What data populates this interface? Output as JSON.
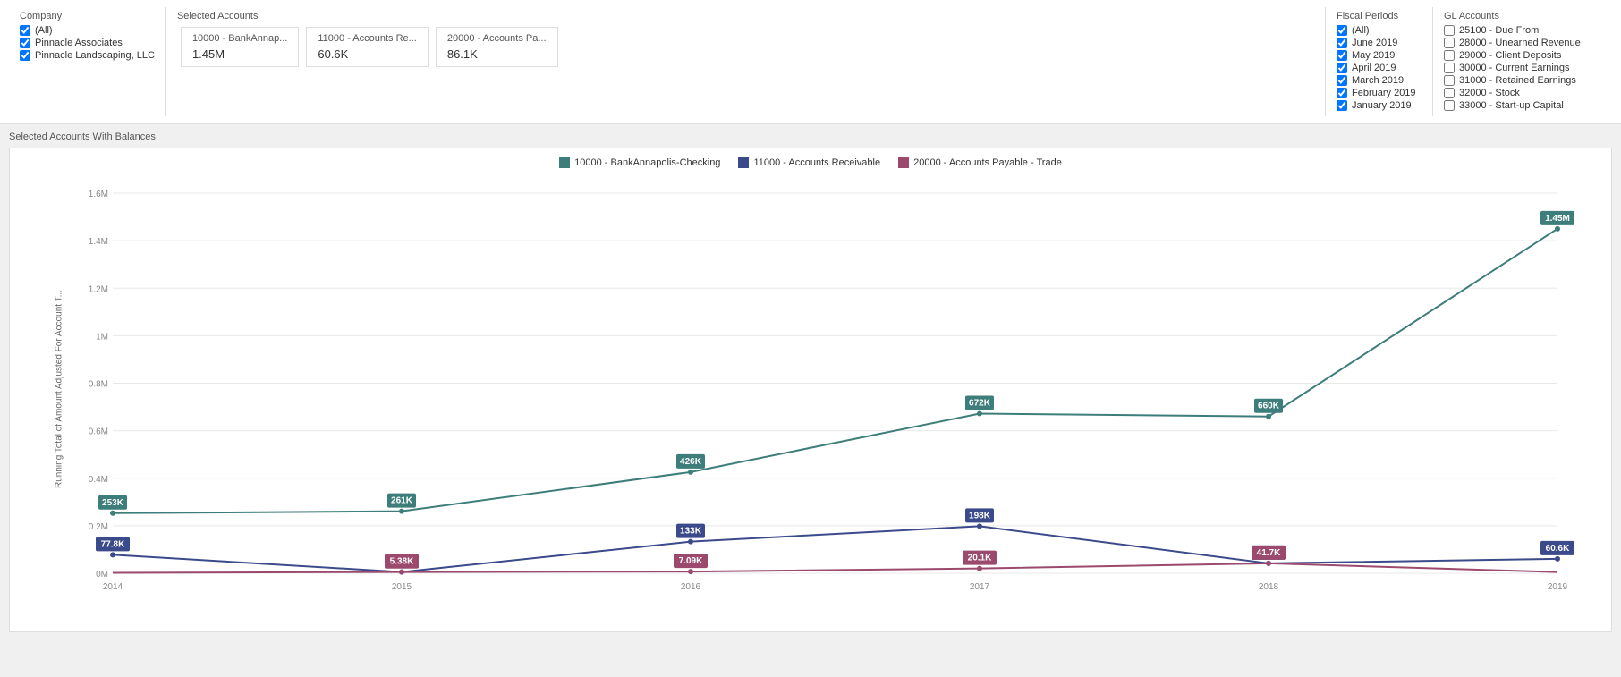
{
  "filters": {
    "company": {
      "title": "Company",
      "items": [
        {
          "label": "(All)",
          "checked": true
        },
        {
          "label": "Pinnacle Associates",
          "checked": true
        },
        {
          "label": "Pinnacle Landscaping, LLC",
          "checked": true
        }
      ]
    },
    "selected_accounts": {
      "title": "Selected Accounts",
      "cards": [
        {
          "name": "10000 - BankAnnap...",
          "value": "1.45M"
        },
        {
          "name": "11000 - Accounts Re...",
          "value": "60.6K"
        },
        {
          "name": "20000 - Accounts Pa...",
          "value": "86.1K"
        }
      ]
    },
    "fiscal_periods": {
      "title": "Fiscal Periods",
      "items": [
        {
          "label": "(All)",
          "checked": true
        },
        {
          "label": "June 2019",
          "checked": true
        },
        {
          "label": "May 2019",
          "checked": true
        },
        {
          "label": "April 2019",
          "checked": true
        },
        {
          "label": "March 2019",
          "checked": true
        },
        {
          "label": "February 2019",
          "checked": true
        },
        {
          "label": "January 2019",
          "checked": true
        }
      ]
    },
    "gl_accounts": {
      "title": "GL Accounts",
      "items": [
        {
          "label": "25100 - Due From",
          "checked": false
        },
        {
          "label": "28000 - Unearned Revenue",
          "checked": false
        },
        {
          "label": "29000 - Client Deposits",
          "checked": false
        },
        {
          "label": "30000 - Current Earnings",
          "checked": false
        },
        {
          "label": "31000 - Retained Earnings",
          "checked": false
        },
        {
          "label": "32000 - Stock",
          "checked": false
        },
        {
          "label": "33000 - Start-up Capital",
          "checked": false
        }
      ]
    }
  },
  "chart": {
    "section_title": "Selected Accounts With Balances",
    "y_axis_label": "Running Total of Amount Adjusted For Account T...",
    "legend": [
      {
        "label": "10000 - BankAnnapolis-Checking",
        "color": "#3d7d7a"
      },
      {
        "label": "11000 - Accounts Receivable",
        "color": "#3b4a8a"
      },
      {
        "label": "20000 - Accounts Payable - Trade",
        "color": "#9b4a6e"
      }
    ],
    "y_ticks": [
      "1.6M",
      "1.4M",
      "1.2M",
      "1M",
      "0.8M",
      "0.6M",
      "0.4M",
      "0.2M",
      "0M"
    ],
    "x_ticks": [
      "2014",
      "2015",
      "2016",
      "2017",
      "2018",
      "2019"
    ],
    "series": [
      {
        "name": "10000 - BankAnnapolis-Checking",
        "color": "#3d7d7a",
        "points": [
          {
            "x": "2014",
            "y": 253,
            "label": "253K"
          },
          {
            "x": "2015",
            "y": 261,
            "label": "261K"
          },
          {
            "x": "2016",
            "y": 426,
            "label": "426K"
          },
          {
            "x": "2017",
            "y": 672,
            "label": "672K"
          },
          {
            "x": "2018",
            "y": 660,
            "label": "660K"
          },
          {
            "x": "2019",
            "y": 1450,
            "label": "1.45M"
          }
        ]
      },
      {
        "name": "11000 - Accounts Receivable",
        "color": "#3b4a8a",
        "points": [
          {
            "x": "2014",
            "y": 77.8,
            "label": "77.8K"
          },
          {
            "x": "2015",
            "y": 5.38,
            "label": "5.38K"
          },
          {
            "x": "2016",
            "y": 133,
            "label": "133K"
          },
          {
            "x": "2017",
            "y": 198,
            "label": "198K"
          },
          {
            "x": "2018",
            "y": 41.7,
            "label": "41.7K"
          },
          {
            "x": "2019",
            "y": 60.6,
            "label": "60.6K"
          }
        ]
      },
      {
        "name": "20000 - Accounts Payable - Trade",
        "color": "#9b4a6e",
        "points": [
          {
            "x": "2014",
            "y": 2,
            "label": ""
          },
          {
            "x": "2015",
            "y": 5.38,
            "label": "5.38K"
          },
          {
            "x": "2016",
            "y": 7.09,
            "label": "7.09K"
          },
          {
            "x": "2017",
            "y": 20.1,
            "label": "20.1K"
          },
          {
            "x": "2018",
            "y": 41.7,
            "label": "41.7K"
          },
          {
            "x": "2019",
            "y": 5,
            "label": ""
          }
        ]
      }
    ]
  }
}
